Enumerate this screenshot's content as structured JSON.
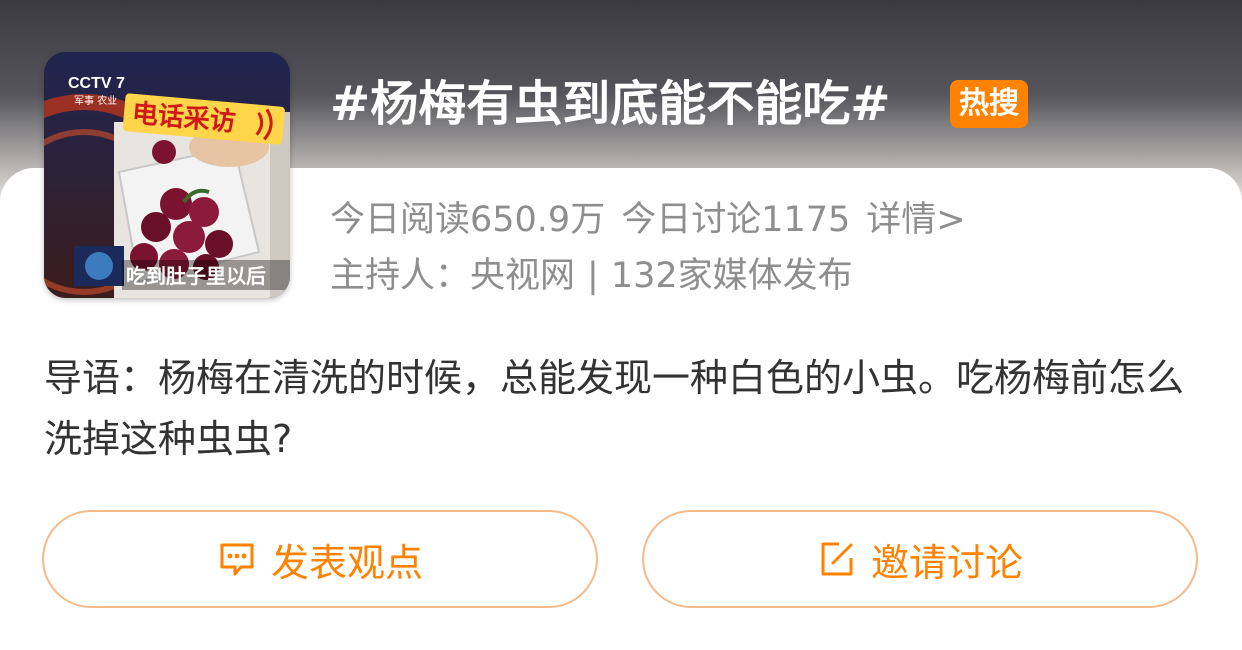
{
  "topic": {
    "title": "#杨梅有虫到底能不能吃#",
    "badge": "热搜",
    "reads_today": "今日阅读650.9万",
    "discussions_today": "今日讨论1175",
    "details_link": "详情>",
    "host": "主持人：央视网",
    "media_count": "132家媒体发布"
  },
  "thumbnail": {
    "channel_logo": "CCTV 7",
    "channel_sub": "军事 农业",
    "banner_text": "电话采访",
    "caption_text": "吃到肚子里以后"
  },
  "lead": {
    "text": "导语：杨梅在清洗的时候，总能发现一种白色的小虫。吃杨梅前怎么洗掉这种虫虫?"
  },
  "actions": {
    "post_opinion": "发表观点",
    "invite_discussion": "邀请讨论"
  },
  "colors": {
    "accent": "#ff8200",
    "button_border": "#f6b98a",
    "meta_text": "#8e8e8e",
    "body_text": "#333333"
  },
  "icons": {
    "post_opinion": "comment-bubble-icon",
    "invite_discussion": "edit-pen-icon"
  }
}
